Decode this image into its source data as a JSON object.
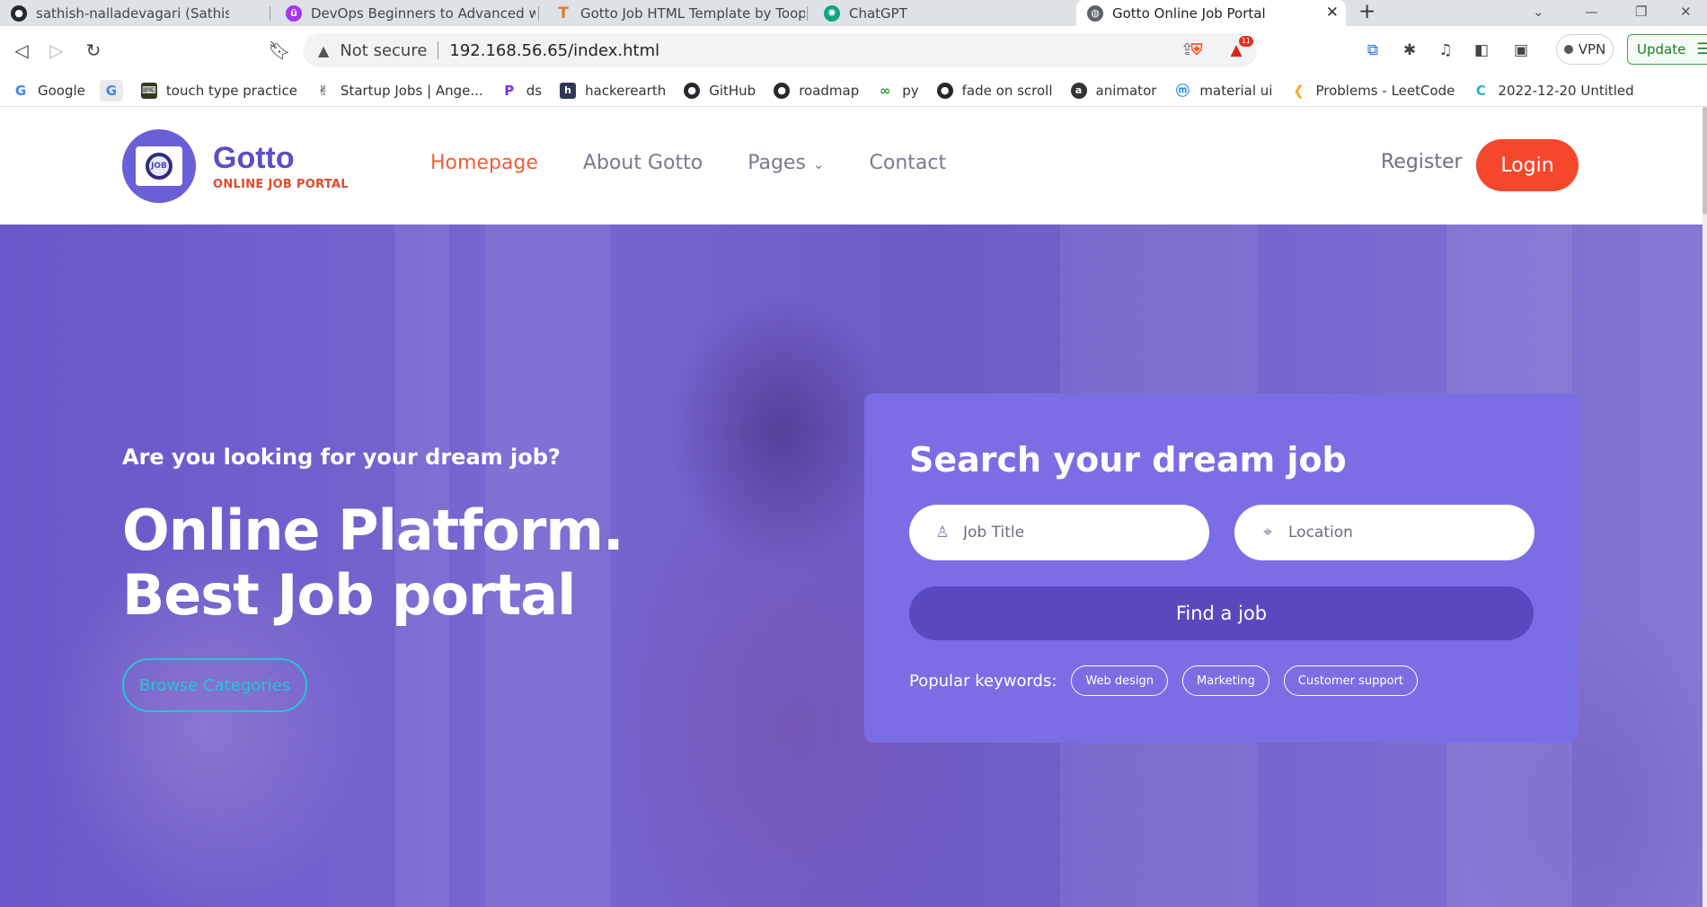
{
  "browser": {
    "tabs": [
      {
        "title": "sathish-nalladevagari (Sathish reddy) /",
        "icon": "github-icon",
        "color": "#24292e"
      },
      {
        "title": "DevOps Beginners to Advanced with P",
        "icon": "udemy-icon",
        "color": "#a435f0"
      },
      {
        "title": "Gotto Job HTML Template by Tooplate",
        "icon": "tooplate-icon",
        "color": "#e87722"
      },
      {
        "title": "ChatGPT",
        "icon": "chatgpt-icon",
        "color": "#10a37f"
      },
      {
        "title": "Gotto Online Job Portal",
        "icon": "globe-icon",
        "color": "#5f6368",
        "active": true
      }
    ],
    "address": {
      "security_label": "Not secure",
      "url": "192.168.56.65/index.html"
    },
    "rewards_badge": "11",
    "vpn_label": "VPN",
    "update_label": "Update",
    "bookmarks": [
      {
        "label": "Google",
        "icon": "google-icon",
        "color": "#4285f4"
      },
      {
        "label": "",
        "icon": "google-g-icon",
        "color": "#4285f4"
      },
      {
        "label": "touch type practice",
        "icon": "keyboard-icon",
        "color": "#2e3b1f"
      },
      {
        "label": "Startup Jobs | Ange...",
        "icon": "angellist-icon",
        "color": "#222222"
      },
      {
        "label": "ds",
        "icon": "ds-icon",
        "color": "#7b2ff7"
      },
      {
        "label": "hackerearth",
        "icon": "hackerearth-icon",
        "color": "#323754"
      },
      {
        "label": "GitHub",
        "icon": "github-icon",
        "color": "#24292e"
      },
      {
        "label": "roadmap",
        "icon": "github-icon",
        "color": "#24292e"
      },
      {
        "label": "py",
        "icon": "infinity-icon",
        "color": "#2e9a3a"
      },
      {
        "label": "fade on scroll",
        "icon": "github-icon",
        "color": "#24292e"
      },
      {
        "label": "animator",
        "icon": "animator-icon",
        "color": "#333333"
      },
      {
        "label": "material ui",
        "icon": "material-ui-icon",
        "color": "#1e88e5"
      },
      {
        "label": "Problems - LeetCode",
        "icon": "leetcode-icon",
        "color": "#ffa116"
      },
      {
        "label": "2022-12-20 Untitled",
        "icon": "codepen-c-icon",
        "color": "#21b8c2"
      }
    ]
  },
  "site": {
    "logo": {
      "name": "Gotto",
      "tagline": "ONLINE JOB PORTAL",
      "badge_text": "JOB"
    },
    "nav": {
      "items": [
        {
          "label": "Homepage",
          "active": true
        },
        {
          "label": "About Gotto"
        },
        {
          "label": "Pages",
          "dropdown": true
        },
        {
          "label": "Contact"
        }
      ],
      "register_label": "Register",
      "login_label": "Login"
    },
    "hero": {
      "subtitle": "Are you looking for your dream job?",
      "title_line1": "Online Platform.",
      "title_line2": "Best Job portal",
      "browse_label": "Browse Categories"
    },
    "search": {
      "title": "Search your dream job",
      "job_title_placeholder": "Job Title",
      "location_placeholder": "Location",
      "find_label": "Find a job",
      "keywords_label": "Popular keywords:",
      "keywords": [
        "Web design",
        "Marketing",
        "Customer support"
      ]
    }
  },
  "colors": {
    "accent_orange": "#f5472b",
    "brand_purple": "#5a4fc4",
    "card_purple": "#7b6ee5",
    "button_purple": "#5a49be",
    "browse_cyan": "#26c4d8"
  }
}
